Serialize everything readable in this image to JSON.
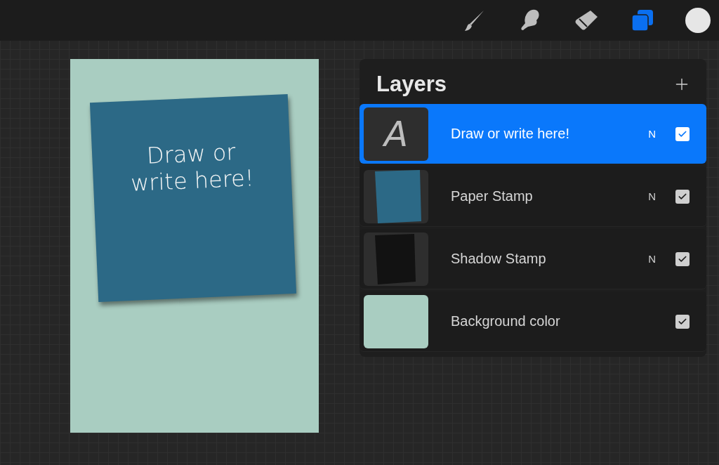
{
  "toolbar": {
    "tools": [
      {
        "kind": "brush",
        "selected": false
      },
      {
        "kind": "smudge",
        "selected": false
      },
      {
        "kind": "eraser",
        "selected": false
      },
      {
        "kind": "layers",
        "selected": true
      }
    ]
  },
  "canvas": {
    "note_text": "Draw or write here!"
  },
  "layers": {
    "title": "Layers",
    "items": [
      {
        "kind": "text",
        "glyph": "A",
        "name": "Draw or write here!",
        "blend": "N",
        "visible": true,
        "selected": true
      },
      {
        "kind": "paper",
        "name": "Paper Stamp",
        "blend": "N",
        "visible": true,
        "selected": false
      },
      {
        "kind": "shadow",
        "name": "Shadow Stamp",
        "blend": "N",
        "visible": true,
        "selected": false
      },
      {
        "kind": "background",
        "name": "Background color",
        "visible": true,
        "selected": false
      }
    ]
  }
}
